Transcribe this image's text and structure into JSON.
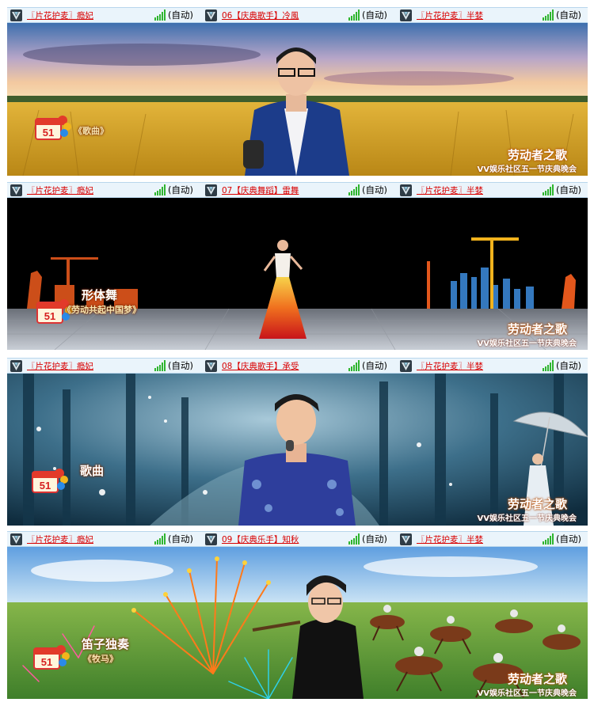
{
  "rows": [
    {
      "slots": [
        {
          "name": "〖片花护麦〗瘾妃",
          "status": "(自动)"
        },
        {
          "name": "06【庆典歌手】冷風",
          "status": "(自动)"
        },
        {
          "name": "〖片花护麦〗半婪",
          "status": "(自动)"
        }
      ],
      "program_line1": "",
      "program_line2": "《歌曲》",
      "brand_line1": "劳动者之歌",
      "brand_line2": "VV娱乐社区五一节庆典晚会",
      "badge": "51"
    },
    {
      "slots": [
        {
          "name": "〖片花护麦〗瘾妃",
          "status": "(自动)"
        },
        {
          "name": "07【庆典舞蹈】雷舞",
          "status": "(自动)"
        },
        {
          "name": "〖片花护麦〗半婪",
          "status": "(自动)"
        }
      ],
      "program_line1": "形体舞",
      "program_line2": "《劳动共起中国梦》",
      "brand_line1": "劳动者之歌",
      "brand_line2": "VV娱乐社区五一节庆典晚会",
      "badge": "51"
    },
    {
      "slots": [
        {
          "name": "〖片花护麦〗瘾妃",
          "status": "(自动)"
        },
        {
          "name": "08【庆典歌手】承受",
          "status": "(自动)"
        },
        {
          "name": "〖片花护麦〗半婪",
          "status": "(自动)"
        }
      ],
      "program_line1": "歌曲",
      "program_line2": "",
      "brand_line1": "劳动者之歌",
      "brand_line2": "VV娱乐社区五一节庆典晚会",
      "badge": "51"
    },
    {
      "slots": [
        {
          "name": "〖片花护麦〗瘾妃",
          "status": "(自动)"
        },
        {
          "name": "09【庆典乐手】知秋",
          "status": "(自动)"
        },
        {
          "name": "〖片花护麦〗半婪",
          "status": "(自动)"
        }
      ],
      "program_line1": "笛子独奏",
      "program_line2": "《牧马》",
      "brand_line1": "劳动者之歌",
      "brand_line2": "VV娱乐社区五一节庆典晚会",
      "badge": "51"
    }
  ],
  "icons": {
    "mic_slot_icon": "v-logo-icon",
    "signal_icon": "signal-bars-icon"
  },
  "colors": {
    "link_red": "#d90000",
    "signal_green": "#2fb52f",
    "bar_bg": "#eaf4fb"
  }
}
